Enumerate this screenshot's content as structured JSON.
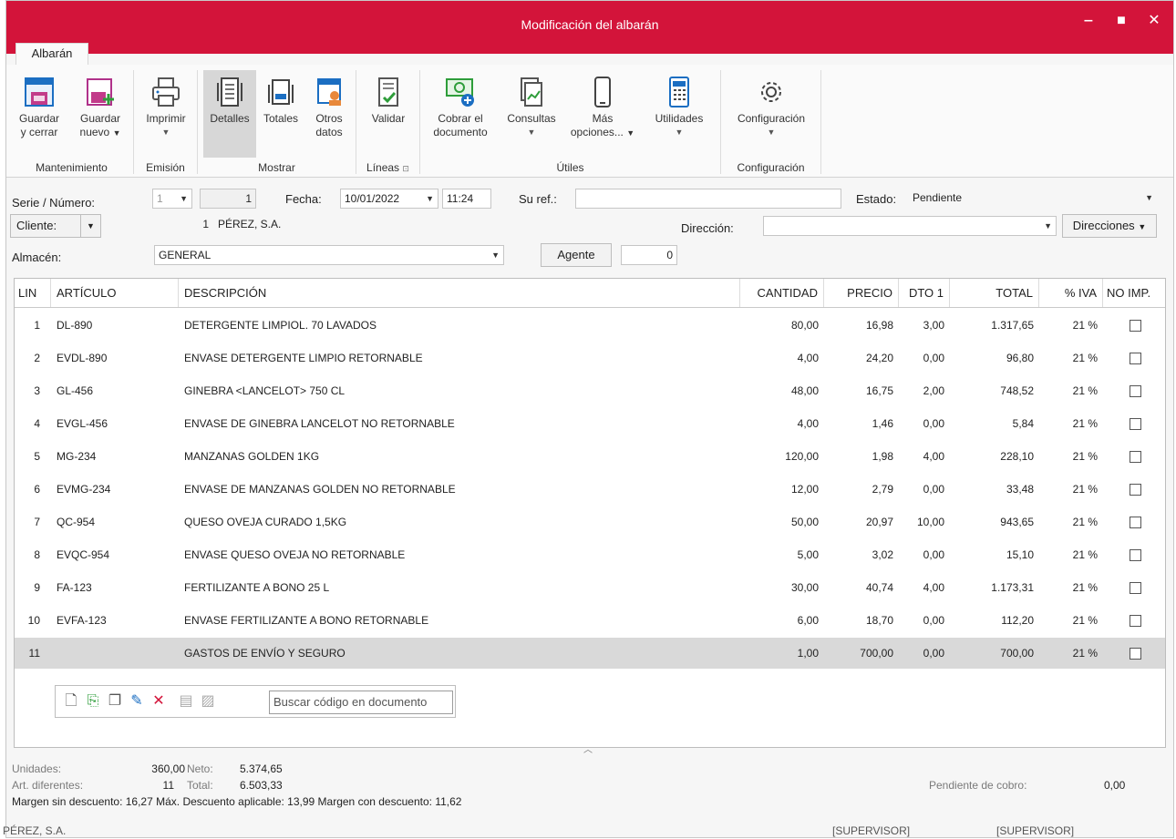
{
  "window": {
    "title": "Modificación del albarán",
    "tab": "Albarán",
    "minimize": "‒",
    "maximize": "■",
    "close": "✕"
  },
  "ribbon": {
    "groups": {
      "mantenimiento": "Mantenimiento",
      "emision": "Emisión",
      "mostrar": "Mostrar",
      "lineas": "Líneas",
      "utiles": "Útiles",
      "configuracion": "Configuración"
    },
    "buttons": {
      "guardar_cerrar_1": "Guardar",
      "guardar_cerrar_2": "y cerrar",
      "guardar_nuevo_1": "Guardar",
      "guardar_nuevo_2": "nuevo",
      "imprimir": "Imprimir",
      "detalles": "Detalles",
      "totales": "Totales",
      "otros_1": "Otros",
      "otros_2": "datos",
      "validar": "Validar",
      "cobrar_1": "Cobrar el",
      "cobrar_2": "documento",
      "consultas": "Consultas",
      "mas_1": "Más",
      "mas_2": "opciones...",
      "utilidades": "Utilidades",
      "configuracion": "Configuración"
    }
  },
  "form": {
    "serie_label": "Serie / Número:",
    "serie_value": "1",
    "numero_value": "1",
    "fecha_label": "Fecha:",
    "fecha_value": "10/01/2022",
    "hora_value": "11:24",
    "suref_label": "Su ref.:",
    "suref_value": "",
    "estado_label": "Estado:",
    "estado_value": "Pendiente",
    "cliente_label": "Cliente:",
    "cliente_code": "1",
    "cliente_name": "PÉREZ, S.A.",
    "direccion_label": "Dirección:",
    "direccion_value": "",
    "direcciones_button": "Direcciones",
    "almacen_label": "Almacén:",
    "almacen_value": "GENERAL",
    "agente_button": "Agente",
    "agente_value": "0"
  },
  "grid": {
    "columns": [
      "LIN",
      "ARTÍCULO",
      "DESCRIPCIÓN",
      "CANTIDAD",
      "PRECIO",
      "DTO 1",
      "TOTAL",
      "% IVA",
      "NO IMP."
    ],
    "rows": [
      {
        "lin": "1",
        "articulo": "DL-890",
        "descripcion": "DETERGENTE LIMPIOL. 70 LAVADOS",
        "cantidad": "80,00",
        "precio": "16,98",
        "dto": "3,00",
        "total": "1.317,65",
        "iva": "21 %"
      },
      {
        "lin": "2",
        "articulo": "EVDL-890",
        "descripcion": "ENVASE DETERGENTE LIMPIO RETORNABLE",
        "cantidad": "4,00",
        "precio": "24,20",
        "dto": "0,00",
        "total": "96,80",
        "iva": "21 %"
      },
      {
        "lin": "3",
        "articulo": "GL-456",
        "descripcion": "GINEBRA <LANCELOT> 750 CL",
        "cantidad": "48,00",
        "precio": "16,75",
        "dto": "2,00",
        "total": "748,52",
        "iva": "21 %"
      },
      {
        "lin": "4",
        "articulo": "EVGL-456",
        "descripcion": "ENVASE DE GINEBRA LANCELOT NO RETORNABLE",
        "cantidad": "4,00",
        "precio": "1,46",
        "dto": "0,00",
        "total": "5,84",
        "iva": "21 %"
      },
      {
        "lin": "5",
        "articulo": "MG-234",
        "descripcion": "MANZANAS GOLDEN 1KG",
        "cantidad": "120,00",
        "precio": "1,98",
        "dto": "4,00",
        "total": "228,10",
        "iva": "21 %"
      },
      {
        "lin": "6",
        "articulo": "EVMG-234",
        "descripcion": "ENVASE DE MANZANAS GOLDEN NO RETORNABLE",
        "cantidad": "12,00",
        "precio": "2,79",
        "dto": "0,00",
        "total": "33,48",
        "iva": "21 %"
      },
      {
        "lin": "7",
        "articulo": "QC-954",
        "descripcion": "QUESO OVEJA CURADO 1,5KG",
        "cantidad": "50,00",
        "precio": "20,97",
        "dto": "10,00",
        "total": "943,65",
        "iva": "21 %"
      },
      {
        "lin": "8",
        "articulo": "EVQC-954",
        "descripcion": "ENVASE QUESO OVEJA NO RETORNABLE",
        "cantidad": "5,00",
        "precio": "3,02",
        "dto": "0,00",
        "total": "15,10",
        "iva": "21 %"
      },
      {
        "lin": "9",
        "articulo": "FA-123",
        "descripcion": "FERTILIZANTE A BONO 25 L",
        "cantidad": "30,00",
        "precio": "40,74",
        "dto": "4,00",
        "total": "1.173,31",
        "iva": "21 %"
      },
      {
        "lin": "10",
        "articulo": "EVFA-123",
        "descripcion": "ENVASE FERTILIZANTE A BONO RETORNABLE",
        "cantidad": "6,00",
        "precio": "18,70",
        "dto": "0,00",
        "total": "112,20",
        "iva": "21 %"
      },
      {
        "lin": "11",
        "articulo": "",
        "descripcion": "GASTOS DE ENVÍO Y SEGURO",
        "cantidad": "1,00",
        "precio": "700,00",
        "dto": "0,00",
        "total": "700,00",
        "iva": "21 %"
      }
    ],
    "search_placeholder": "Buscar código en documento"
  },
  "footer": {
    "unidades_label": "Unidades:",
    "unidades_value": "360,00",
    "neto_label": "Neto:",
    "neto_value": "5.374,65",
    "art_label": "Art. diferentes:",
    "art_value": "11",
    "total_label": "Total:",
    "total_value": "6.503,33",
    "margen_line": "Margen sin descuento: 16,27  Máx. Descuento aplicable: 13,99  Margen con descuento: 11,62",
    "pendiente_label": "Pendiente de cobro:",
    "pendiente_value": "0,00"
  },
  "statusbar": {
    "company": "PÉREZ, S.A.",
    "user1": "[SUPERVISOR]",
    "user2": "[SUPERVISOR]"
  },
  "colors": {
    "title_bar": "#d3143a",
    "selected_row": "#d9d9d9",
    "cursor": "#1e88e5"
  }
}
